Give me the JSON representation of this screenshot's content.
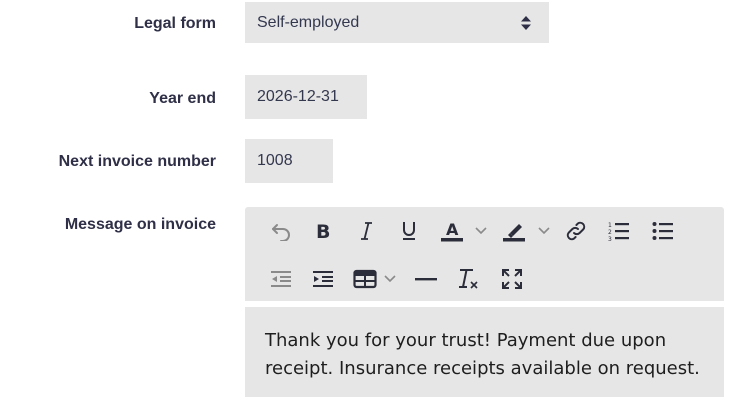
{
  "form": {
    "legal_form": {
      "label": "Legal form",
      "value": "Self-employed"
    },
    "year_end": {
      "label": "Year end",
      "value": "2026-12-31"
    },
    "next_invoice": {
      "label": "Next invoice number",
      "value": "1008"
    },
    "message": {
      "label": "Message on invoice",
      "text": "Thank you for your trust! Payment due upon receipt. Insurance receipts available on request."
    }
  },
  "toolbar": {
    "row1": [
      "undo-icon",
      "bold-icon",
      "italic-icon",
      "underline-icon",
      "font-color-icon",
      "chevron-down-icon",
      "highlight-icon",
      "chevron-down-icon",
      "link-icon",
      "numbered-list-icon",
      "bulleted-list-icon"
    ],
    "row2": [
      "outdent-icon",
      "indent-icon",
      "table-icon",
      "chevron-down-icon",
      "horizontal-line-icon",
      "clear-formatting-icon",
      "fullscreen-icon"
    ]
  },
  "colors": {
    "label": "#2f3047",
    "field_bg": "#e6e6e6",
    "text": "#34384f"
  }
}
